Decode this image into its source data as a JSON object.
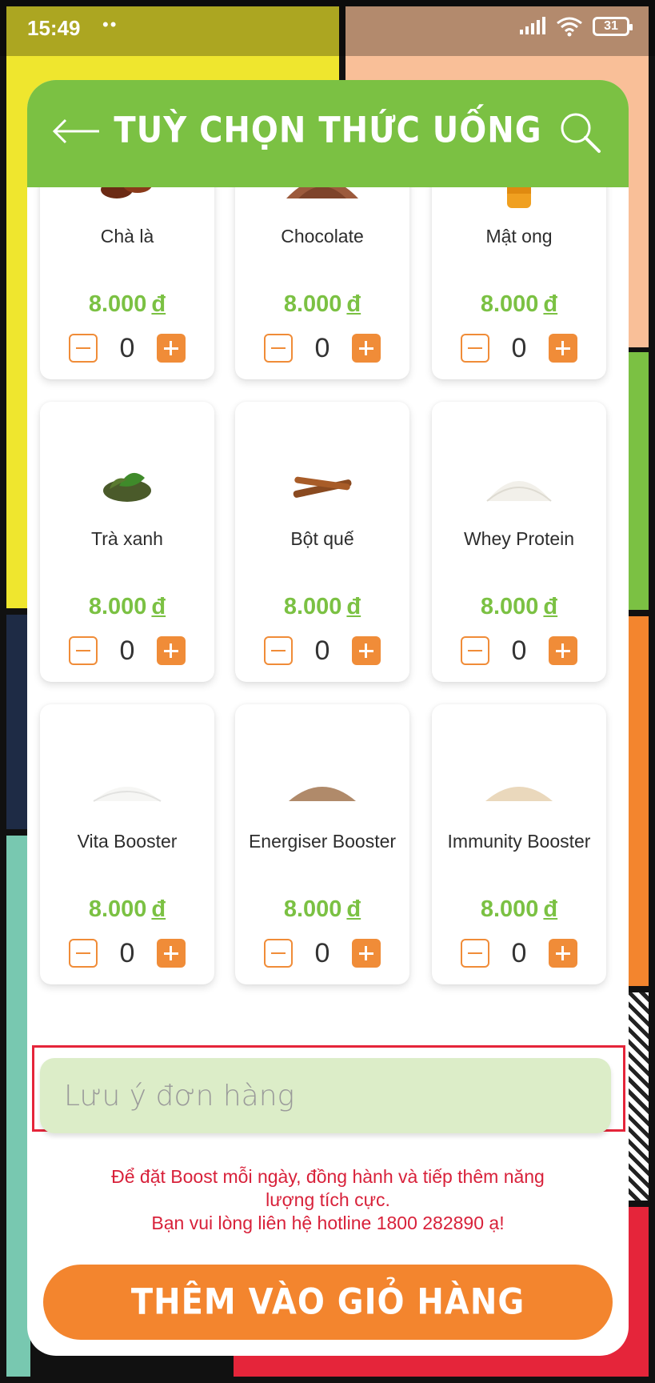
{
  "status_bar": {
    "time": "15:49",
    "dots": "••",
    "battery": "31"
  },
  "header": {
    "title": "TUỲ CHỌN THỨC UỐNG",
    "back_icon": "arrow-left-icon",
    "search_icon": "search-icon"
  },
  "items": [
    {
      "name": "Chà là",
      "price": "8.000",
      "currency": "đ",
      "qty": "0",
      "icon": "dates-icon"
    },
    {
      "name": "Chocolate",
      "price": "8.000",
      "currency": "đ",
      "qty": "0",
      "icon": "cocoa-powder-icon"
    },
    {
      "name": "Mật ong",
      "price": "8.000",
      "currency": "đ",
      "qty": "0",
      "icon": "honey-bottle-icon"
    },
    {
      "name": "Trà xanh",
      "price": "8.000",
      "currency": "đ",
      "qty": "0",
      "icon": "green-tea-icon"
    },
    {
      "name": "Bột quế",
      "price": "8.000",
      "currency": "đ",
      "qty": "0",
      "icon": "cinnamon-icon"
    },
    {
      "name": "Whey Protein",
      "price": "8.000",
      "currency": "đ",
      "qty": "0",
      "icon": "whey-powder-icon"
    },
    {
      "name": "Vita Booster",
      "price": "8.000",
      "currency": "đ",
      "qty": "0",
      "icon": "white-powder-icon"
    },
    {
      "name": "Energiser Booster",
      "price": "8.000",
      "currency": "đ",
      "qty": "0",
      "icon": "brown-powder-icon"
    },
    {
      "name": "Immunity Booster",
      "price": "8.000",
      "currency": "đ",
      "qty": "0",
      "icon": "beige-powder-icon"
    }
  ],
  "note": {
    "placeholder": "Lưu ý đơn hàng",
    "value": ""
  },
  "notice": {
    "line1": "Để đặt Boost mỗi ngày, đồng hành và tiếp thêm năng",
    "line2": "lượng tích cực.",
    "line3": "Bạn vui lòng liên hệ hotline 1800 282890 ạ!"
  },
  "cart_button": {
    "label": "THÊM VÀO GIỎ HÀNG"
  },
  "colors": {
    "brand_green": "#7bc143",
    "accent_orange": "#f3852e",
    "notice_red": "#d8213a",
    "note_bg": "#dcedc8"
  }
}
